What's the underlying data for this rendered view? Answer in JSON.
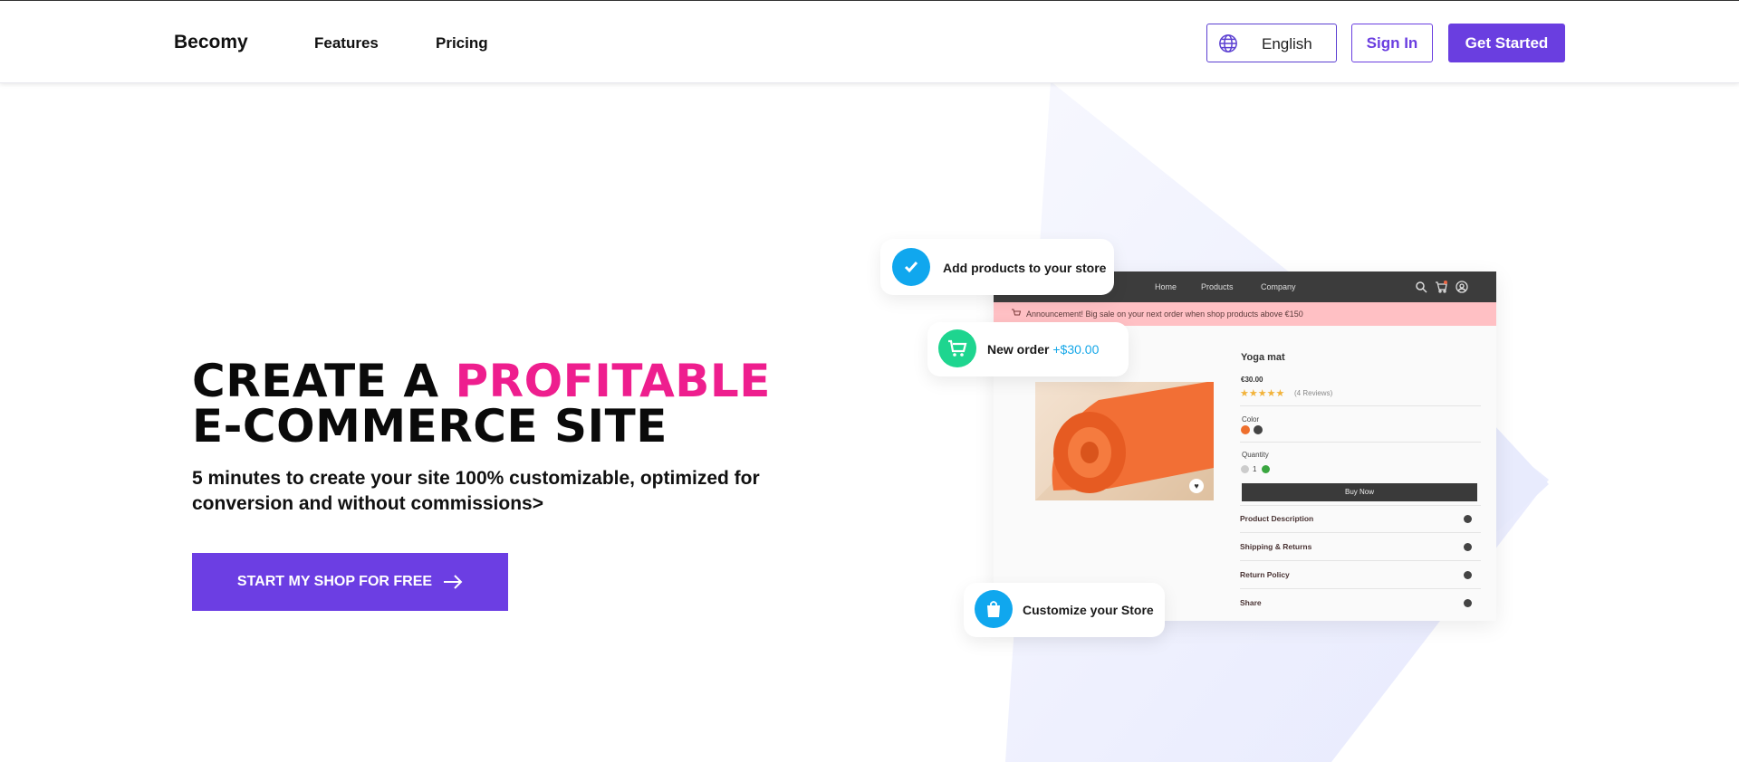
{
  "header": {
    "logo": "Becomy",
    "nav": [
      "Features",
      "Pricing"
    ],
    "language": "English",
    "sign_in": "Sign In",
    "get_started": "Get Started"
  },
  "hero": {
    "title_part1": "CREATE A ",
    "title_highlight": "PROFITABLE",
    "title_line2": "E-COMMERCE SITE",
    "subtitle": "5 minutes to create your site 100% customizable, optimized for conversion and without commissions>",
    "cta": "START MY SHOP FOR FREE"
  },
  "mockup": {
    "nav": [
      "Home",
      "Products",
      "Company"
    ],
    "announcement": "Announcement! Big sale on your next order when shop products above €150",
    "product_title": "Yoga mat",
    "price": "€30.00",
    "stars": "★★★★★",
    "reviews": "(4 Reviews)",
    "color_label": "Color",
    "quantity_label": "Quantity",
    "quantity_value": "1",
    "buy_now": "Buy Now",
    "accordions": [
      "Product Description",
      "Shipping & Returns",
      "Return Policy",
      "Share"
    ]
  },
  "chips": {
    "add_products": "Add products to your store",
    "new_order": "New order",
    "new_order_amount": "+$30.00",
    "customize": "Customize your Store"
  },
  "colors": {
    "brand": "#6a3ee0",
    "accent_pink": "#ee1e8e",
    "chip_blue": "#10a7ee",
    "chip_green": "#1ed58f"
  },
  "icons": [
    "globe-icon",
    "arrow-right-icon",
    "check-icon",
    "cart-icon",
    "bag-icon",
    "search-icon",
    "user-icon",
    "heart-icon"
  ]
}
